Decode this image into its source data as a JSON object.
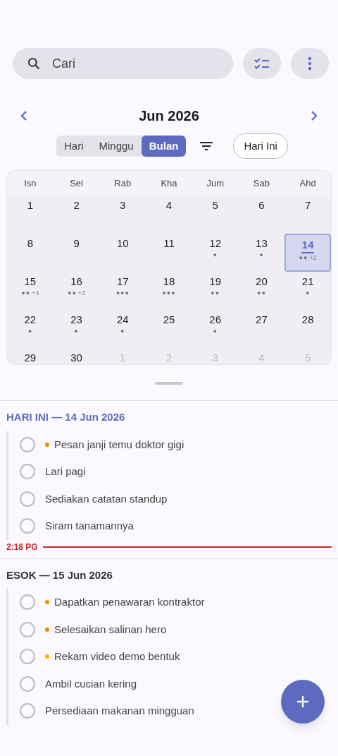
{
  "search": {
    "placeholder": "Cari"
  },
  "month_header": {
    "title": "Jun 2026"
  },
  "view_tabs": [
    {
      "label": "Hari",
      "selected": false
    },
    {
      "label": "Minggu",
      "selected": false
    },
    {
      "label": "Bulan",
      "selected": true
    }
  ],
  "today_button": "Hari Ini",
  "calendar": {
    "weekdays": [
      "Isn",
      "Sel",
      "Rab",
      "Kha",
      "Jum",
      "Sab",
      "Ahd"
    ],
    "days": [
      {
        "day": "1",
        "muted": false,
        "selected": false
      },
      {
        "day": "2",
        "muted": false,
        "selected": false
      },
      {
        "day": "3",
        "muted": false,
        "selected": false
      },
      {
        "day": "4",
        "muted": false,
        "selected": false
      },
      {
        "day": "5",
        "muted": false,
        "selected": false
      },
      {
        "day": "6",
        "muted": false,
        "selected": false
      },
      {
        "day": "7",
        "muted": false,
        "selected": false
      },
      {
        "day": "8",
        "muted": false,
        "selected": false
      },
      {
        "day": "9",
        "muted": false,
        "selected": false
      },
      {
        "day": "10",
        "muted": false,
        "selected": false
      },
      {
        "day": "11",
        "muted": false,
        "selected": false
      },
      {
        "day": "12",
        "muted": false,
        "selected": false,
        "dots": "●"
      },
      {
        "day": "13",
        "muted": false,
        "selected": false,
        "dots": "●"
      },
      {
        "day": "14",
        "muted": false,
        "selected": true,
        "dots": "●●",
        "more": "+2"
      },
      {
        "day": "15",
        "muted": false,
        "selected": false,
        "dots": "●●",
        "more": "+4"
      },
      {
        "day": "16",
        "muted": false,
        "selected": false,
        "dots": "●●",
        "more": "+3"
      },
      {
        "day": "17",
        "muted": false,
        "selected": false,
        "dots": "●●●"
      },
      {
        "day": "18",
        "muted": false,
        "selected": false,
        "dots": "●●●"
      },
      {
        "day": "19",
        "muted": false,
        "selected": false,
        "dots": "●●"
      },
      {
        "day": "20",
        "muted": false,
        "selected": false,
        "dots": "●●"
      },
      {
        "day": "21",
        "muted": false,
        "selected": false,
        "dots": "●"
      },
      {
        "day": "22",
        "muted": false,
        "selected": false,
        "dots": "●"
      },
      {
        "day": "23",
        "muted": false,
        "selected": false,
        "dots": "●"
      },
      {
        "day": "24",
        "muted": false,
        "selected": false,
        "dots": "●"
      },
      {
        "day": "25",
        "muted": false,
        "selected": false
      },
      {
        "day": "26",
        "muted": false,
        "selected": false,
        "dots": "●"
      },
      {
        "day": "27",
        "muted": false,
        "selected": false
      },
      {
        "day": "28",
        "muted": false,
        "selected": false
      },
      {
        "day": "29",
        "muted": false,
        "selected": false
      },
      {
        "day": "30",
        "muted": false,
        "selected": false
      },
      {
        "day": "1",
        "muted": true,
        "selected": false
      },
      {
        "day": "2",
        "muted": true,
        "selected": false
      },
      {
        "day": "3",
        "muted": true,
        "selected": false
      },
      {
        "day": "4",
        "muted": true,
        "selected": false
      },
      {
        "day": "5",
        "muted": true,
        "selected": false
      }
    ]
  },
  "sections": [
    {
      "title": "HARI INI — 14 Jun 2026",
      "kind": "today",
      "tasks": [
        {
          "title": "Pesan janji temu doktor gigi",
          "checked": false,
          "color": "#f08c00"
        },
        {
          "title": "Lari pagi",
          "checked": false
        },
        {
          "title": "Sediakan catatan standup",
          "checked": false
        },
        {
          "title": "Siram tanamannya",
          "checked": false
        }
      ],
      "now_time": "2:18 PG"
    },
    {
      "title": "ESOK — 15 Jun 2026",
      "kind": "other",
      "tasks": [
        {
          "title": "Dapatkan penawaran kontraktor",
          "checked": false,
          "color": "#f08c00"
        },
        {
          "title": "Selesaikan salinan hero",
          "checked": false,
          "color": "#f08c00"
        },
        {
          "title": "Rekam video demo bentuk",
          "checked": false,
          "color": "#f5b400"
        },
        {
          "title": "Ambil cucian kering",
          "checked": false
        },
        {
          "title": "Persediaan makanan mingguan",
          "checked": false
        }
      ]
    }
  ]
}
